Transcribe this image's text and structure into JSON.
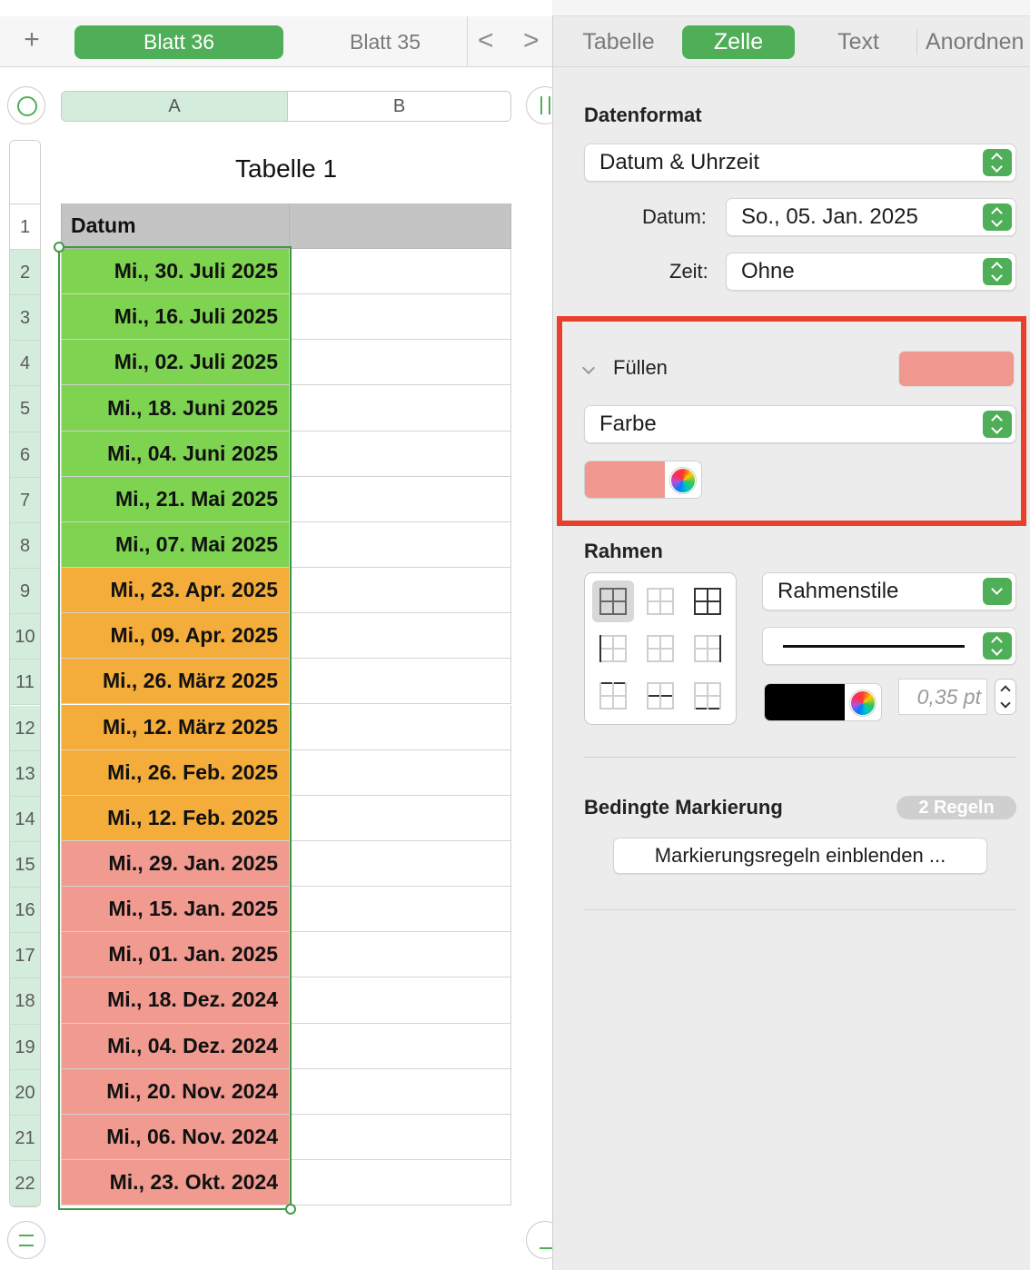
{
  "sheet_tabs": {
    "add_label": "+",
    "items": [
      {
        "label": "Blatt 36",
        "active": true
      },
      {
        "label": "Blatt 35",
        "active": false
      }
    ],
    "prev_label": "<",
    "next_label": ">"
  },
  "columns": [
    "A",
    "B"
  ],
  "table": {
    "title": "Tabelle 1",
    "header": [
      "Datum",
      ""
    ],
    "rows": [
      {
        "num": "2",
        "date": "Mi., 30. Juli 2025",
        "fill": "#7ed350"
      },
      {
        "num": "3",
        "date": "Mi., 16. Juli 2025",
        "fill": "#7ed350"
      },
      {
        "num": "4",
        "date": "Mi., 02. Juli 2025",
        "fill": "#7ed350"
      },
      {
        "num": "5",
        "date": "Mi., 18. Juni 2025",
        "fill": "#7ed350"
      },
      {
        "num": "6",
        "date": "Mi., 04. Juni 2025",
        "fill": "#7ed350"
      },
      {
        "num": "7",
        "date": "Mi., 21. Mai 2025",
        "fill": "#7ed350"
      },
      {
        "num": "8",
        "date": "Mi., 07. Mai 2025",
        "fill": "#7ed350"
      },
      {
        "num": "9",
        "date": "Mi., 23. Apr. 2025",
        "fill": "#f4ac3b"
      },
      {
        "num": "10",
        "date": "Mi., 09. Apr. 2025",
        "fill": "#f4ac3b"
      },
      {
        "num": "11",
        "date": "Mi., 26. März 2025",
        "fill": "#f4ac3b"
      },
      {
        "num": "12",
        "date": "Mi., 12. März 2025",
        "fill": "#f4ac3b"
      },
      {
        "num": "13",
        "date": "Mi., 26. Feb. 2025",
        "fill": "#f4ac3b"
      },
      {
        "num": "14",
        "date": "Mi., 12. Feb. 2025",
        "fill": "#f4ac3b"
      },
      {
        "num": "15",
        "date": "Mi., 29. Jan. 2025",
        "fill": "#f09a90"
      },
      {
        "num": "16",
        "date": "Mi., 15. Jan. 2025",
        "fill": "#f09a90"
      },
      {
        "num": "17",
        "date": "Mi., 01. Jan. 2025",
        "fill": "#f09a90"
      },
      {
        "num": "18",
        "date": "Mi., 18. Dez. 2024",
        "fill": "#f09a90"
      },
      {
        "num": "19",
        "date": "Mi., 04. Dez. 2024",
        "fill": "#f09a90"
      },
      {
        "num": "20",
        "date": "Mi., 20. Nov. 2024",
        "fill": "#f09a90"
      },
      {
        "num": "21",
        "date": "Mi., 06. Nov. 2024",
        "fill": "#f09a90"
      },
      {
        "num": "22",
        "date": "Mi., 23. Okt. 2024",
        "fill": "#f09a90"
      }
    ]
  },
  "inspector": {
    "tabs": [
      "Tabelle",
      "Zelle",
      "Text",
      "Anordnen"
    ],
    "active_tab": "Zelle",
    "data_format": {
      "heading": "Datenformat",
      "value": "Datum & Uhrzeit",
      "date_label": "Datum:",
      "date_value": "So., 05. Jan. 2025",
      "time_label": "Zeit:",
      "time_value": "Ohne"
    },
    "fill": {
      "heading": "Füllen",
      "type": "Farbe",
      "color": "#f0988f"
    },
    "border": {
      "heading": "Rahmen",
      "style": "Rahmenstile",
      "color": "#000000",
      "width": "0,35 pt"
    },
    "conditional": {
      "heading": "Bedingte Markierung",
      "badge": "2 Regeln",
      "button": "Markierungsregeln einblenden ..."
    }
  },
  "colors": {
    "accent": "#4fae58",
    "highlight_box": "#e8402b"
  }
}
